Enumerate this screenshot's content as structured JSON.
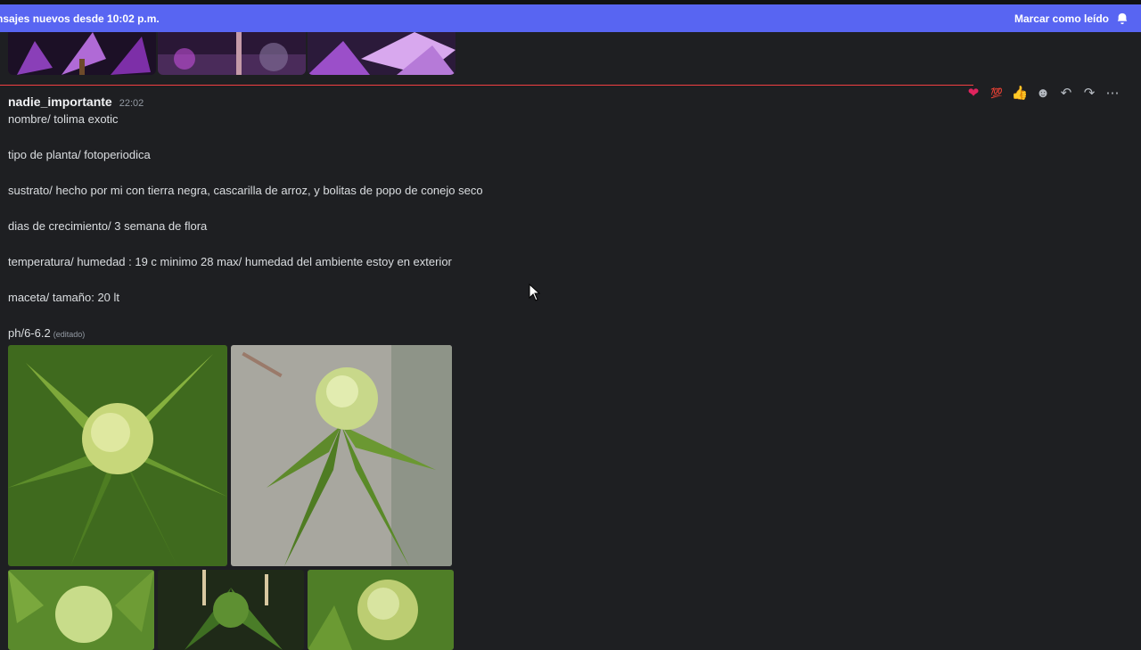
{
  "new_messages_bar": {
    "text": "nsajes nuevos desde 10:02 p.m.",
    "mark_read_label": "Marcar como leído"
  },
  "reactions": [
    {
      "icon": "heart-icon",
      "glyph": "❤"
    },
    {
      "icon": "hundred-icon",
      "glyph": "💯"
    },
    {
      "icon": "thumbs-up-icon",
      "glyph": "👍"
    },
    {
      "icon": "add-reaction-icon",
      "glyph": "☻"
    },
    {
      "icon": "reply-icon",
      "glyph": "↶"
    },
    {
      "icon": "forward-icon",
      "glyph": "↷"
    },
    {
      "icon": "more-icon",
      "glyph": "⋯"
    }
  ],
  "message": {
    "username": "nadie_importante",
    "time": "22:02",
    "lines": [
      "nombre/ tolima exotic",
      "tipo de planta/ fotoperiodica",
      "sustrato/ hecho por mi con tierra negra, cascarilla de arroz, y bolitas de popo de conejo seco",
      "dias de crecimiento/ 3 semana de flora",
      "temperatura/ humedad : 19 c minimo 28 max/ humedad del ambiente estoy en exterior",
      "maceta/ tamaño: 20 lt",
      "ph/6-6.2"
    ],
    "edited_label": "(editado)"
  },
  "colors": {
    "accent": "#5865f2",
    "new_divider": "#f23f42",
    "background": "#1e1f22"
  }
}
